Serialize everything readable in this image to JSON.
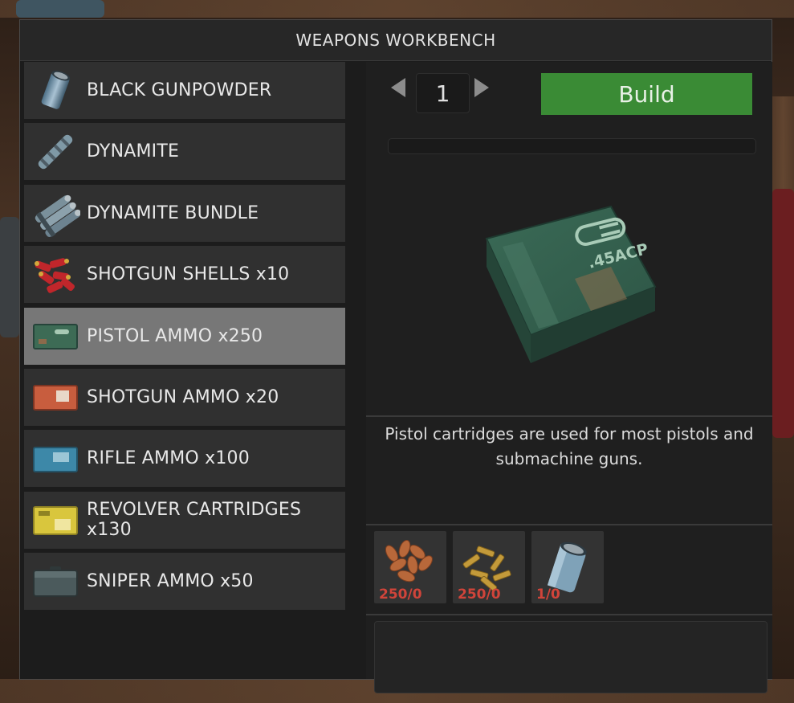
{
  "window": {
    "title": "WEAPONS WORKBENCH"
  },
  "recipes": [
    {
      "label": "BLACK GUNPOWDER",
      "icon": "gunpowder-can-icon",
      "selected": false
    },
    {
      "label": "DYNAMITE",
      "icon": "dynamite-stick-icon",
      "selected": false
    },
    {
      "label": "DYNAMITE BUNDLE",
      "icon": "dynamite-bundle-icon",
      "selected": false
    },
    {
      "label": "SHOTGUN SHELLS x10",
      "icon": "shotgun-shells-icon",
      "selected": false
    },
    {
      "label": "PISTOL AMMO x250",
      "icon": "pistol-ammo-box-icon",
      "selected": true
    },
    {
      "label": "SHOTGUN AMMO x20",
      "icon": "shotgun-ammo-box-icon",
      "selected": false
    },
    {
      "label": "RIFLE AMMO x100",
      "icon": "rifle-ammo-box-icon",
      "selected": false
    },
    {
      "label": "REVOLVER CARTRIDGES x130",
      "icon": "revolver-ammo-box-icon",
      "selected": false
    },
    {
      "label": "SNIPER AMMO x50",
      "icon": "sniper-ammo-box-icon",
      "selected": false
    }
  ],
  "craft": {
    "quantity": "1",
    "build_label": "Build",
    "progress": 0,
    "preview_text": ".45ACP",
    "description": "Pistol cartridges are used for most pistols and submachine guns.",
    "requirements": [
      {
        "icon": "copper-bullets-icon",
        "count": "250/0"
      },
      {
        "icon": "brass-casings-icon",
        "count": "250/0"
      },
      {
        "icon": "gunpowder-can-icon",
        "count": "1/0"
      }
    ]
  },
  "colors": {
    "build": "#3a8b35",
    "missing": "#d0443a",
    "selected": "#777777"
  }
}
